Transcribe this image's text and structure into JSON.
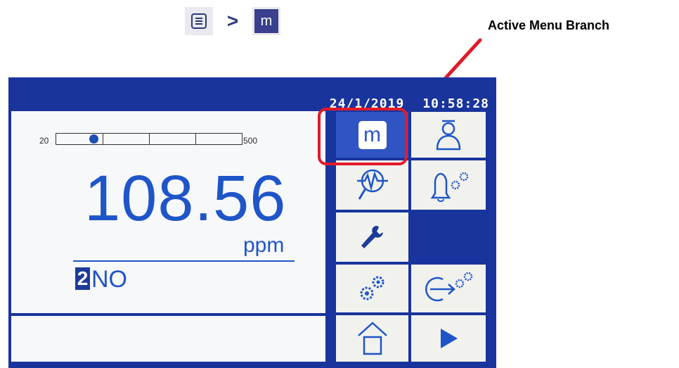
{
  "breadcrumb": {
    "home_icon": "list-icon",
    "separator": ">",
    "menu_letter": "m"
  },
  "annotation": {
    "text": "Active Menu Branch",
    "arrow_color": "#e11a2a"
  },
  "device": {
    "date": "24/1/2019",
    "time": "10:58:28",
    "bargraph": {
      "min_label": "20",
      "max_label": "500",
      "level_fraction": 0.2
    },
    "reading": "108.56",
    "unit": "ppm",
    "channel_number": "2",
    "channel_name": "NO",
    "menu": {
      "active": "m",
      "buttons": [
        {
          "id": "measurement",
          "label": "m",
          "icon": "m-icon"
        },
        {
          "id": "user",
          "icon": "person-icon"
        },
        {
          "id": "diagnostics",
          "icon": "diagnostics-magnifier-icon"
        },
        {
          "id": "alarm-settings",
          "icon": "bell-gears-icon"
        },
        {
          "id": "service",
          "icon": "wrench-icon"
        },
        {
          "id": "settings",
          "icon": "gears-icon"
        },
        {
          "id": "logout",
          "icon": "logout-gears-icon"
        },
        {
          "id": "home",
          "icon": "home-icon"
        },
        {
          "id": "next",
          "icon": "play-icon"
        }
      ]
    }
  },
  "colors": {
    "screen_bg": "#19349c",
    "accent": "#1e55c8",
    "selected": "#2f55c4",
    "highlight": "#e11a2a"
  }
}
